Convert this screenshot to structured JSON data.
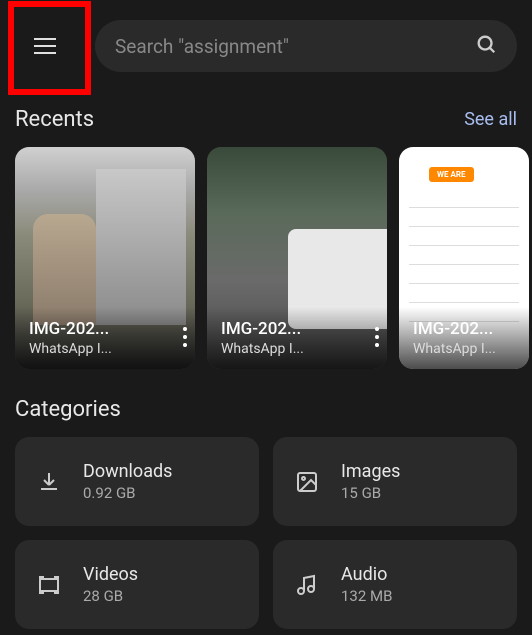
{
  "search": {
    "placeholder": "Search \"assignment\""
  },
  "recents": {
    "title": "Recents",
    "see_all": "See all",
    "items": [
      {
        "title": "IMG-202...",
        "subtitle": "WhatsApp I..."
      },
      {
        "title": "IMG-202...",
        "subtitle": "WhatsApp I..."
      },
      {
        "title": "IMG-202...",
        "subtitle": "WhatsApp I..."
      }
    ]
  },
  "categories": {
    "title": "Categories",
    "items": [
      {
        "label": "Downloads",
        "size": "0.92 GB"
      },
      {
        "label": "Images",
        "size": "15 GB"
      },
      {
        "label": "Videos",
        "size": "28 GB"
      },
      {
        "label": "Audio",
        "size": "132 MB"
      }
    ]
  },
  "hiring_text": "WE ARE"
}
